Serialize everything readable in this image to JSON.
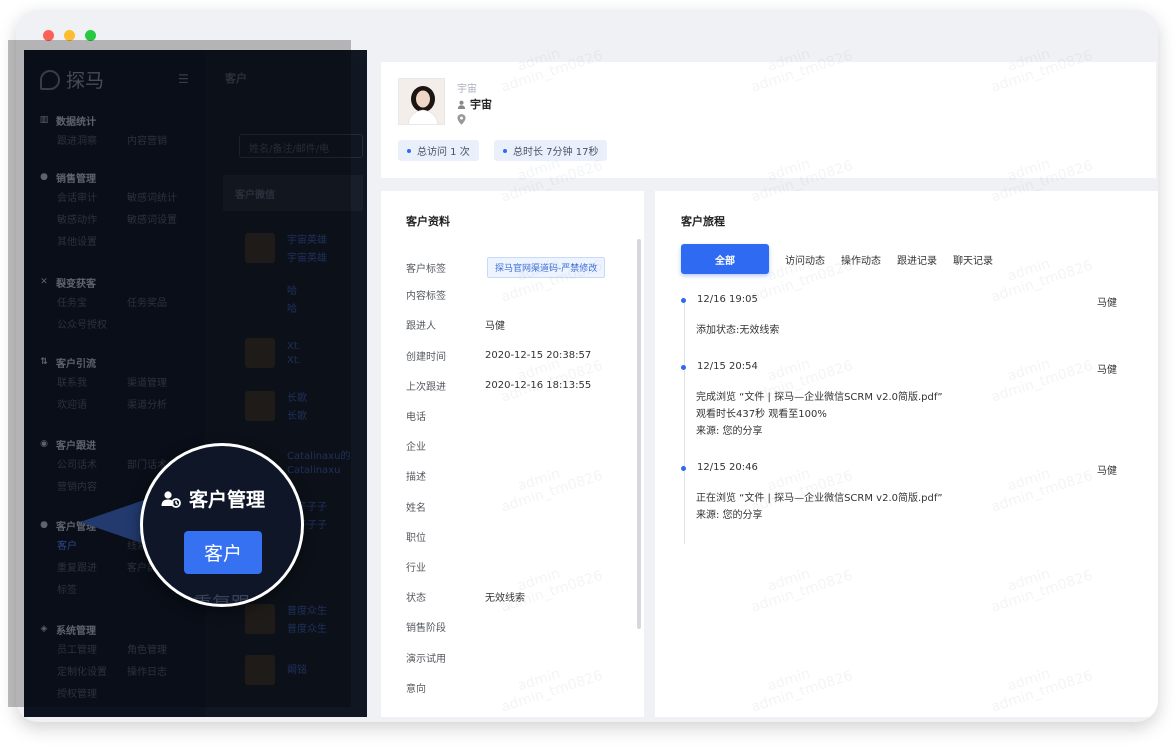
{
  "window": {
    "dot_colors": [
      "#fe5f57",
      "#febc2e",
      "#28c840"
    ]
  },
  "sidebar": {
    "brand": "探马",
    "groups": [
      {
        "title": "数据统计",
        "icon": "bar-chart-icon",
        "items": [
          "跟进洞察",
          "内容营销"
        ]
      },
      {
        "title": "销售管理",
        "icon": "user-icon",
        "items": [
          "会话审计",
          "敏感词统计",
          "敏感动作",
          "敏感词设置",
          "其他设置"
        ]
      },
      {
        "title": "裂变获客",
        "icon": "share-icon",
        "items": [
          "任务宝",
          "任务奖品",
          "公众号授权"
        ]
      },
      {
        "title": "客户引流",
        "icon": "funnel-icon",
        "items": [
          "联系我",
          "渠道管理",
          "欢迎语",
          "渠道分析"
        ]
      },
      {
        "title": "客户跟进",
        "icon": "target-icon",
        "items": [
          "公司话术",
          "部门话术",
          "营销内容"
        ]
      },
      {
        "title": "客户管理",
        "icon": "customers-icon",
        "items": [
          "客户",
          "线索",
          "重复跟进",
          "客户群",
          "标签"
        ]
      },
      {
        "title": "系统管理",
        "icon": "settings-icon",
        "items": [
          "员工管理",
          "角色管理",
          "定制化设置",
          "操作日志",
          "授权管理"
        ]
      }
    ]
  },
  "list": {
    "title": "客户",
    "search_placeholder": "姓名/备注/邮件/电",
    "column_header": "客户微信",
    "rows": [
      {
        "line1": "宇宙英雄",
        "line2": "宇宙英雄"
      },
      {
        "line1": "哈",
        "line2": "哈"
      },
      {
        "line1": "Xt.",
        "line2": "Xt."
      },
      {
        "line1": "长歌",
        "line2": "长歌"
      },
      {
        "line1": "Catalinaxu的",
        "line2": "Catalinaxu"
      },
      {
        "line1": "子子子子",
        "line2": "子子子子"
      },
      {
        "line1": "普度众生",
        "line2": "普度众生"
      },
      {
        "line1": "阚铭",
        "line2": ""
      }
    ]
  },
  "profile": {
    "alias": "宇宙",
    "name": "宇宙",
    "visits": "总访问 1 次",
    "duration": "总时长 7分钟 17秒"
  },
  "info": {
    "title": "客户资料",
    "fields": [
      {
        "label": "客户标签",
        "value": "探马官网渠道码-严禁修改",
        "chip": true
      },
      {
        "label": "内容标签",
        "value": ""
      },
      {
        "label": "跟进人",
        "value": "马健"
      },
      {
        "label": "创建时间",
        "value": "2020-12-15 20:38:57"
      },
      {
        "label": "上次跟进",
        "value": "2020-12-16 18:13:55"
      },
      {
        "label": "电话",
        "value": ""
      },
      {
        "label": "企业",
        "value": ""
      },
      {
        "label": "描述",
        "value": ""
      },
      {
        "label": "姓名",
        "value": ""
      },
      {
        "label": "职位",
        "value": ""
      },
      {
        "label": "行业",
        "value": ""
      },
      {
        "label": "状态",
        "value": "无效线索"
      },
      {
        "label": "销售阶段",
        "value": ""
      },
      {
        "label": "演示试用",
        "value": ""
      },
      {
        "label": "意向",
        "value": ""
      }
    ]
  },
  "journey": {
    "title": "客户旅程",
    "tabs": [
      "全部",
      "访问动态",
      "操作动态",
      "跟进记录",
      "聊天记录"
    ],
    "events": [
      {
        "time": "12/16   19:05",
        "user": "马健",
        "lines": [
          "添加状态:无效线索"
        ]
      },
      {
        "time": "12/15   20:54",
        "user": "马健",
        "lines": [
          "完成浏览 “文件 | 探马—企业微信SCRM v2.0简版.pdf”",
          "观看时长437秒  观看至100%",
          "来源:  您的分享"
        ]
      },
      {
        "time": "12/15   20:46",
        "user": "马健",
        "lines": [
          "正在浏览 “文件 | 探马—企业微信SCRM v2.0简版.pdf”",
          "来源:  您的分享"
        ]
      }
    ]
  },
  "watermark": {
    "line1": "admin",
    "line2": "admin_tm0826"
  },
  "callout": {
    "title": "客户管理",
    "button": "客户",
    "ghost_text": "重复跟"
  }
}
